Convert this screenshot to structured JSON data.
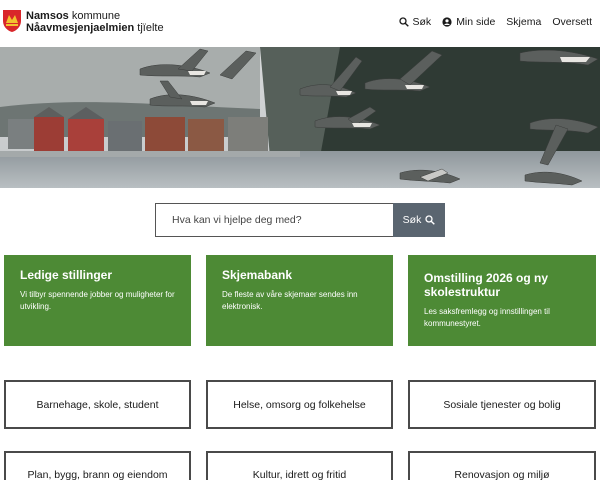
{
  "brand": {
    "line1_bold": "Namsos",
    "line1_rest": " kommune",
    "line2_bold": "Nåavmesjenjaelmien",
    "line2_rest": " tjïelte"
  },
  "nav": {
    "search": "Søk",
    "my_page": "Min side",
    "forms": "Skjema",
    "translate": "Oversett"
  },
  "search": {
    "placeholder": "Hva kan vi hjelpe deg med?",
    "button": "Søk"
  },
  "highlights": [
    {
      "title": "Ledige stillinger",
      "text": "Vi tilbyr spennende jobber og muligheter for utvikling."
    },
    {
      "title": "Skjemabank",
      "text": "De fleste av våre skjemaer sendes inn elektronisk."
    },
    {
      "title": "Omstilling 2026 og ny skolestruktur",
      "text": "Les saksfremlegg og innstillingen til kommunestyret."
    }
  ],
  "categories": [
    "Barnehage, skole, student",
    "Helse, omsorg og folkehelse",
    "Sosiale tjenester og bolig",
    "Plan, bygg, brann og eiendom",
    "Kultur, idrett og fritid",
    "Renovasjon og miljø"
  ],
  "colors": {
    "green": "#4d8a35",
    "search_button": "#5a6570"
  }
}
